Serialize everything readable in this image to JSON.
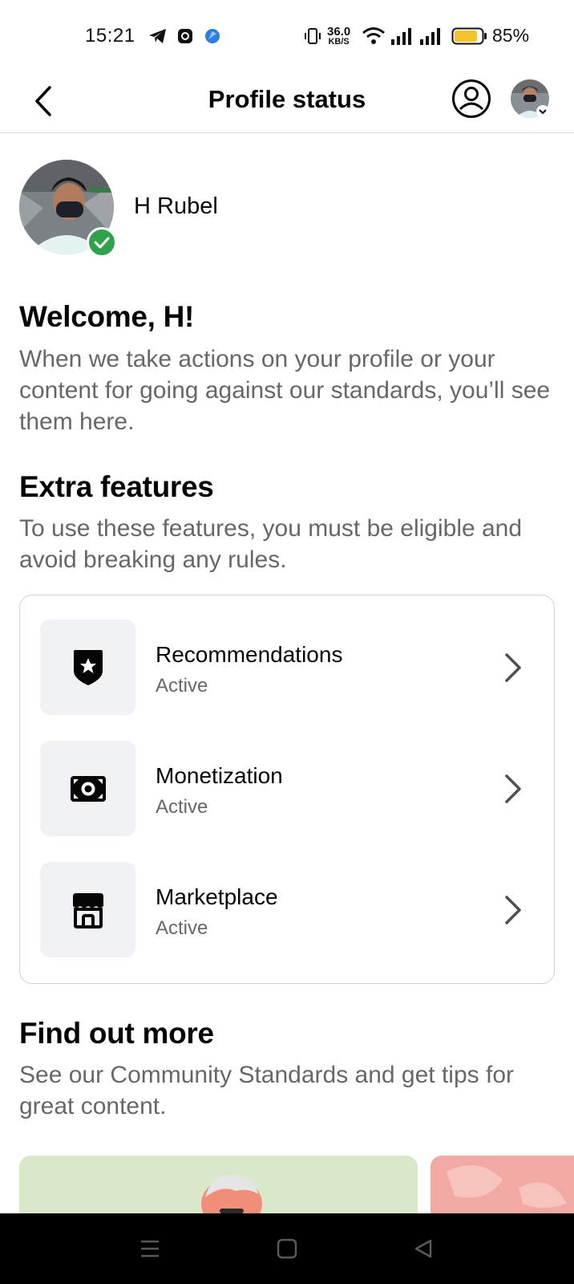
{
  "status_bar": {
    "time": "15:21",
    "net_speed_value": "36.0",
    "net_speed_unit": "KB/S",
    "battery_percent": "85%",
    "battery_level": 0.85,
    "battery_color": "#f5c42c",
    "icons": [
      "telegram-icon",
      "app-icon",
      "browser-icon",
      "vibrate-icon",
      "wifi-icon",
      "signal-icon",
      "signal-icon",
      "battery-icon"
    ]
  },
  "header": {
    "title": "Profile status",
    "icons": [
      "back-icon",
      "profile-switch-icon",
      "avatar"
    ]
  },
  "profile": {
    "name": "H Rubel",
    "verified_color": "#31a24c"
  },
  "welcome": {
    "heading": "Welcome, H!",
    "body": "When we take actions on your profile or your content for going against our standards, you’ll see them here."
  },
  "extra_features": {
    "heading": "Extra features",
    "body": "To use these features, you must be eligible and avoid breaking any rules.",
    "items": [
      {
        "name": "Recommendations",
        "status": "Active",
        "icon": "shield-star-icon"
      },
      {
        "name": "Monetization",
        "status": "Active",
        "icon": "money-icon"
      },
      {
        "name": "Marketplace",
        "status": "Active",
        "icon": "shop-icon"
      }
    ]
  },
  "find_out_more": {
    "heading": "Find out more",
    "body": "See our Community Standards and get tips for great content."
  },
  "nav_bar": {
    "icons": [
      "menu-icon",
      "home-icon",
      "back-triangle-icon"
    ]
  },
  "colors": {
    "text_primary": "#050505",
    "text_secondary": "#65676b",
    "tile_bg": "#f0f2f5",
    "card_border": "#d0d2d6"
  }
}
